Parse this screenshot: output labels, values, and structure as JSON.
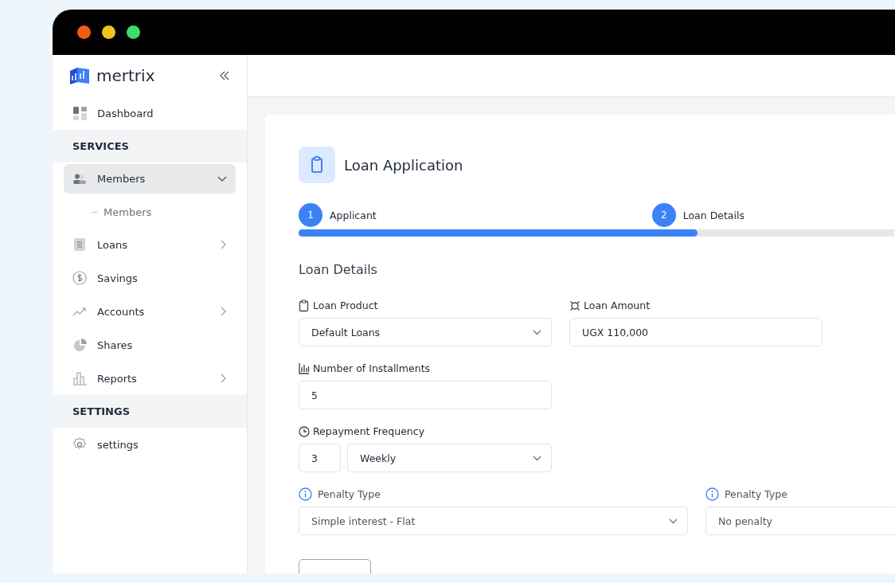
{
  "sidebar": {
    "brand": "mertrix",
    "items": [
      {
        "kind": "link",
        "label": "Dashboard",
        "selected": false
      },
      {
        "kind": "section",
        "label": "SERVICES"
      },
      {
        "kind": "group",
        "label": "Members",
        "selected": true,
        "expanded": true,
        "children": [
          {
            "label": "Members",
            "selected": false
          }
        ]
      },
      {
        "kind": "group",
        "label": "Loans",
        "selected": false,
        "expanded": false
      },
      {
        "kind": "link",
        "label": "Savings",
        "selected": false
      },
      {
        "kind": "group",
        "label": "Accounts",
        "selected": false,
        "expanded": false
      },
      {
        "kind": "link",
        "label": "Shares",
        "selected": false
      },
      {
        "kind": "group",
        "label": "Reports",
        "selected": false,
        "expanded": false
      },
      {
        "kind": "section",
        "label": "SETTINGS"
      },
      {
        "kind": "link",
        "label": "settings",
        "selected": false
      }
    ]
  },
  "card": {
    "title": "Loan Application",
    "steps": [
      {
        "number": "1",
        "label": "Applicant"
      },
      {
        "number": "2",
        "label": "Loan Details"
      }
    ],
    "progress": {
      "level": 0.67
    },
    "section_title": "Loan Details",
    "rows": [
      [
        {
          "label": "Loan Product",
          "controls": [
            {
              "kind": "select",
              "value": "Default Loans"
            }
          ]
        },
        {
          "label": "Loan Amount",
          "controls": [
            {
              "kind": "input",
              "value": "UGX 110,000"
            }
          ]
        }
      ],
      [
        {
          "label": "Number of Installments",
          "controls": [
            {
              "kind": "input",
              "value": "5"
            }
          ]
        }
      ],
      [
        {
          "label": "Repayment Frequency",
          "controls": [
            {
              "kind": "input",
              "value": "3"
            },
            {
              "kind": "select",
              "value": "Weekly"
            }
          ]
        }
      ],
      [
        {
          "label": "Penalty Type",
          "info": true,
          "controls": [
            {
              "kind": "select",
              "value": "Simple interest - Flat"
            }
          ]
        },
        {
          "label": "Penalty Type",
          "info": true,
          "controls": [
            {
              "kind": "select",
              "value": "No penalty"
            }
          ]
        }
      ]
    ]
  }
}
